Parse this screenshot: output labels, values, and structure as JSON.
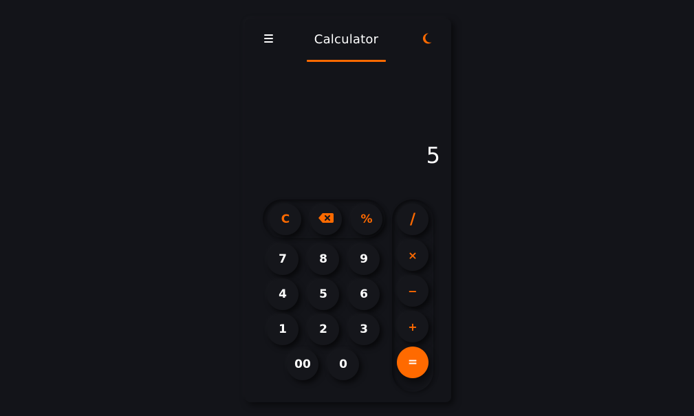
{
  "header": {
    "title": "Calculator",
    "menu_icon": "menu-icon",
    "theme_icon": "moon-icon"
  },
  "display": {
    "value": "5"
  },
  "colors": {
    "background": "#131419",
    "accent": "#ff6a00",
    "text": "#ffffff"
  },
  "keys": {
    "clear": "C",
    "backspace_icon": "backspace-icon",
    "percent": "%",
    "divide": "/",
    "multiply": "×",
    "subtract": "−",
    "add": "+",
    "equals": "=",
    "d7": "7",
    "d8": "8",
    "d9": "9",
    "d4": "4",
    "d5": "5",
    "d6": "6",
    "d1": "1",
    "d2": "2",
    "d3": "3",
    "d00": "00",
    "d0": "0"
  }
}
